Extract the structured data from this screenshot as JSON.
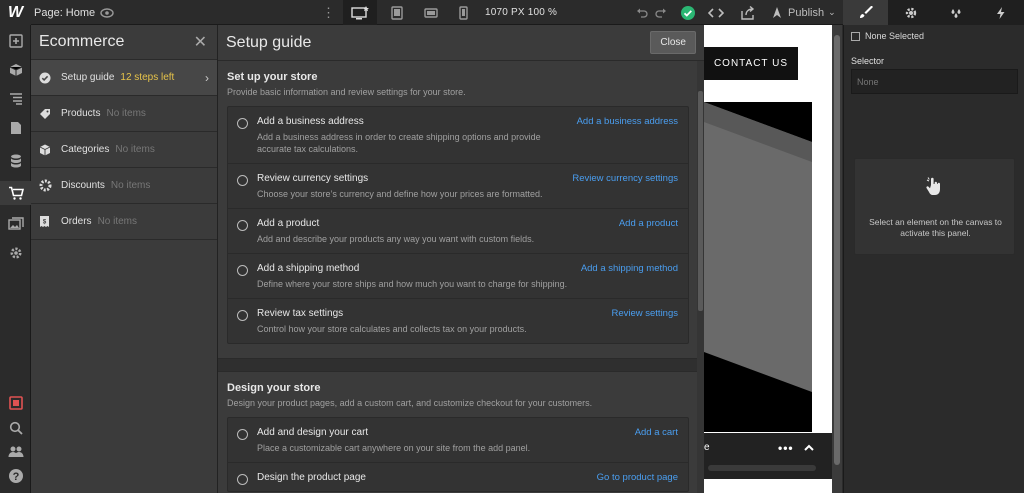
{
  "topbar": {
    "logo": "W",
    "page_label": "Page: Home",
    "width_label": "1070 PX  100 %",
    "publish_label": "Publish"
  },
  "ecommerce": {
    "title": "Ecommerce",
    "items": [
      {
        "label": "Setup guide",
        "sub": "12 steps left",
        "icon": "check-circle-icon"
      },
      {
        "label": "Products",
        "sub": "No items",
        "icon": "tag-icon"
      },
      {
        "label": "Categories",
        "sub": "No items",
        "icon": "box-icon"
      },
      {
        "label": "Discounts",
        "sub": "No items",
        "icon": "gear-badge-icon"
      },
      {
        "label": "Orders",
        "sub": "No items",
        "icon": "receipt-icon"
      }
    ]
  },
  "setup": {
    "title": "Setup guide",
    "close_label": "Close",
    "sections": [
      {
        "title": "Set up your store",
        "desc": "Provide basic information and review settings for your store.",
        "tasks": [
          {
            "title": "Add a business address",
            "desc": "Add a business address in order to create shipping options and provide accurate tax calculations.",
            "link": "Add a business address"
          },
          {
            "title": "Review currency settings",
            "desc": "Choose your store’s currency and define how your prices are formatted.",
            "link": "Review currency settings"
          },
          {
            "title": "Add a product",
            "desc": "Add and describe your products any way you want with custom fields.",
            "link": "Add a product"
          },
          {
            "title": "Add a shipping method",
            "desc": "Define where your store ships and how much you want to charge for shipping.",
            "link": "Add a shipping method"
          },
          {
            "title": "Review tax settings",
            "desc": "Control how your store calculates and collects tax on your products.",
            "link": "Review settings"
          }
        ]
      },
      {
        "title": "Design your store",
        "desc": "Design your product pages, add a custom cart, and customize checkout for your customers.",
        "tasks": [
          {
            "title": "Add and design your cart",
            "desc": "Place a customizable cart anywhere on your site from the add panel.",
            "link": "Add a cart"
          },
          {
            "title": "Design the product page",
            "desc": "",
            "link": "Go to product page"
          }
        ]
      }
    ]
  },
  "canvas": {
    "contact_label": "CONTACT US",
    "edge_text": "e"
  },
  "right_panel": {
    "none_selected": "None Selected",
    "selector_label": "Selector",
    "selector_placeholder": "None",
    "hint_text": "Select an element on the canvas to activate this panel."
  },
  "colors": {
    "accent_link": "#4a9ef0",
    "steps_left": "#e6c34a",
    "status_green": "#2bb673"
  }
}
